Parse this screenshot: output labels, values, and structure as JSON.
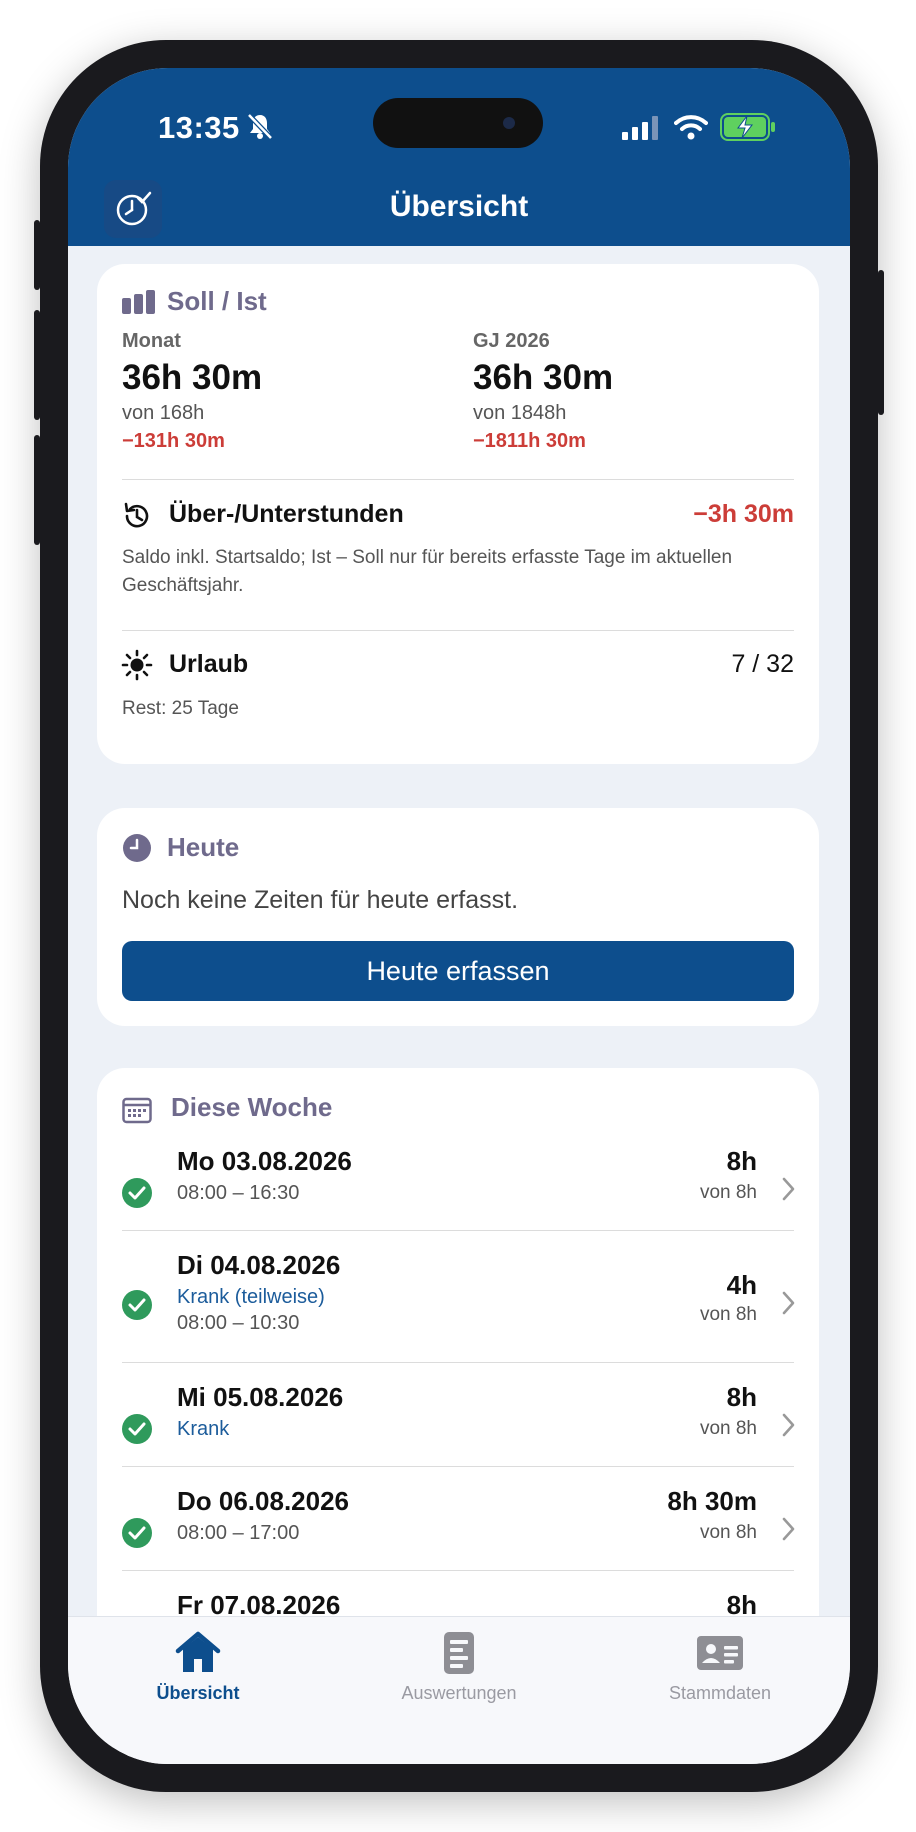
{
  "status_bar": {
    "time": "13:35"
  },
  "nav": {
    "title": "Übersicht",
    "app_icon": "clock-check-icon"
  },
  "soll_ist": {
    "title": "Soll / Ist",
    "month": {
      "label": "Monat",
      "value": "36h 30m",
      "of": "von 168h",
      "diff": "−131h 30m"
    },
    "year": {
      "label": "GJ 2026",
      "value": "36h 30m",
      "of": "von 1848h",
      "diff": "−1811h 30m"
    },
    "overtime": {
      "label": "Über-/Unterstunden",
      "value": "−3h 30m",
      "note": "Saldo inkl. Startsaldo; Ist – Soll nur für bereits erfasste Tage im aktuellen Geschäftsjahr."
    },
    "vacation": {
      "label": "Urlaub",
      "value": "7 / 32",
      "rest": "Rest: 25 Tage"
    }
  },
  "today": {
    "title": "Heute",
    "message": "Noch keine Zeiten für heute erfasst.",
    "button": "Heute erfassen"
  },
  "week": {
    "title": "Diese Woche",
    "days": [
      {
        "date": "Mo 03.08.2026",
        "line1": "08:00 – 16:30",
        "line2": "",
        "hours": "8h",
        "of": "von 8h"
      },
      {
        "date": "Di 04.08.2026",
        "line1": "Krank (teilweise)",
        "line2": "08:00 – 10:30",
        "hours": "4h",
        "of": "von 8h"
      },
      {
        "date": "Mi 05.08.2026",
        "line1": "Krank",
        "line2": "",
        "hours": "8h",
        "of": "von 8h"
      },
      {
        "date": "Do 06.08.2026",
        "line1": "08:00 – 17:00",
        "line2": "",
        "hours": "8h 30m",
        "of": "von 8h"
      },
      {
        "date": "Fr 07.08.2026",
        "line1": "",
        "line2": "",
        "hours": "8h",
        "of": ""
      }
    ]
  },
  "tabs": [
    {
      "label": "Übersicht",
      "icon": "home-icon",
      "active": true
    },
    {
      "label": "Auswertungen",
      "icon": "report-icon",
      "active": false
    },
    {
      "label": "Stammdaten",
      "icon": "id-card-icon",
      "active": false
    }
  ],
  "colors": {
    "primary": "#0d4e8d",
    "negative": "#cc3d38",
    "success": "#2f9a5c",
    "section_title": "#6f6a8c",
    "link_blue": "#1c5c9b"
  }
}
